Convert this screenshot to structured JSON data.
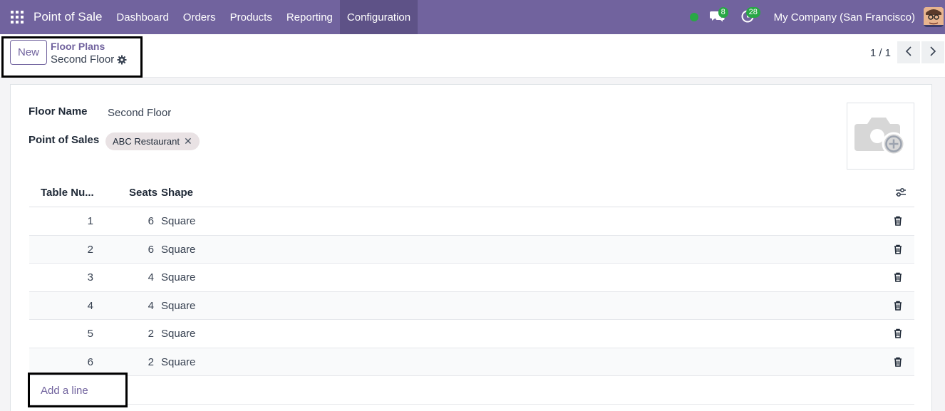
{
  "navbar": {
    "app_title": "Point of Sale",
    "menu": [
      "Dashboard",
      "Orders",
      "Products",
      "Reporting",
      "Configuration"
    ],
    "active_menu": "Configuration",
    "messages_count": "8",
    "activities_count": "28",
    "company": "My Company (San Francisco)",
    "colors": {
      "brand": "#71639e",
      "status_online": "#28a745"
    }
  },
  "control_panel": {
    "new_label": "New",
    "breadcrumb_parent": "Floor Plans",
    "breadcrumb_current": "Second Floor",
    "pager": "1 / 1"
  },
  "form": {
    "floor_name_label": "Floor Name",
    "floor_name_value": "Second Floor",
    "pos_label": "Point of Sales",
    "pos_tag": "ABC Restaurant",
    "image_icon": "camera-add-icon"
  },
  "table": {
    "headers": {
      "number": "Table Nu...",
      "seats": "Seats",
      "shape": "Shape"
    },
    "rows": [
      {
        "number": "1",
        "seats": "6",
        "shape": "Square"
      },
      {
        "number": "2",
        "seats": "6",
        "shape": "Square"
      },
      {
        "number": "3",
        "seats": "4",
        "shape": "Square"
      },
      {
        "number": "4",
        "seats": "4",
        "shape": "Square"
      },
      {
        "number": "5",
        "seats": "2",
        "shape": "Square"
      },
      {
        "number": "6",
        "seats": "2",
        "shape": "Square"
      }
    ],
    "add_line_label": "Add a line"
  }
}
